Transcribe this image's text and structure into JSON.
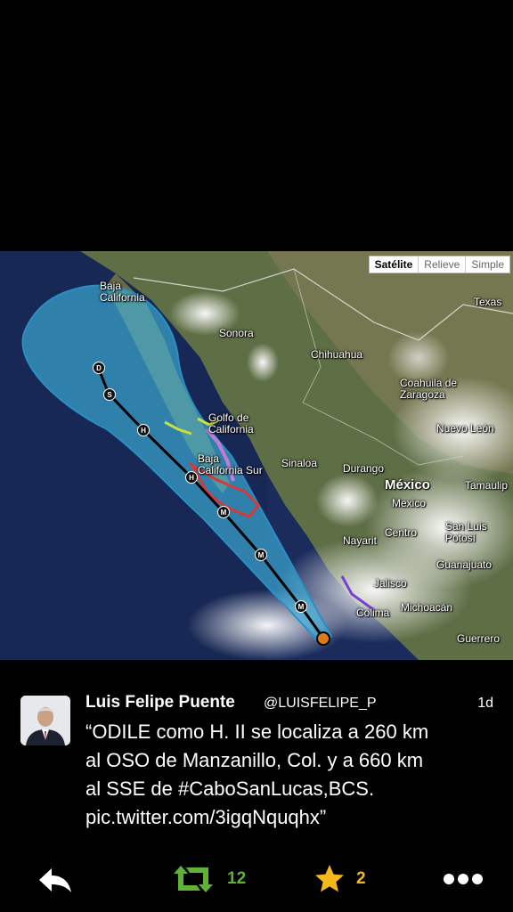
{
  "map": {
    "type_buttons": [
      "Satélite",
      "Relieve",
      "Simple"
    ],
    "labels": {
      "texas": "Texas",
      "baja_california": "Baja\nCalifornia",
      "sonora": "Sonora",
      "chihuahua": "Chihuahua",
      "coahuila": "Coahuila de\nZaragoza",
      "nuevo_leon": "Nuevo León",
      "golfo": "Golfo de\nCalifornia",
      "sinaloa": "Sinaloa",
      "durango": "Durango",
      "baja_sur": "Baja\nCalifornia Sur",
      "mexico_country": "México",
      "mexico_state": "Mexico",
      "tamaulipas": "Tamaulip",
      "nayarit": "Nayarit",
      "centro": "Centro",
      "san_luis": "San Luis\nPotosí",
      "guanajuato": "Guanajuato",
      "jalisco": "Jalisco",
      "colima": "Colima",
      "michoacan": "Michoacán",
      "guerrero": "Guerrero"
    },
    "track_markers": [
      "D",
      "S",
      "H",
      "H",
      "M",
      "M",
      "M"
    ]
  },
  "tweet": {
    "name": "Luis Felipe Puente",
    "handle": "@LUISFELIPE_P",
    "time": "1d",
    "lines": [
      "“ODILE como H. II se localiza a 260 km",
      "al OSO de Manzanillo, Col. y a 660 km",
      "al SSE de #CaboSanLucas,BCS.",
      "pic.twitter.com/3igqNquqhx”"
    ]
  },
  "actions": {
    "retweet_count": "12",
    "favorite_count": "2"
  },
  "colors": {
    "retweet": "#5fb236",
    "favorite": "#f5b81c",
    "cone": "#3db6e0",
    "ocean": "#1b2c5c"
  }
}
